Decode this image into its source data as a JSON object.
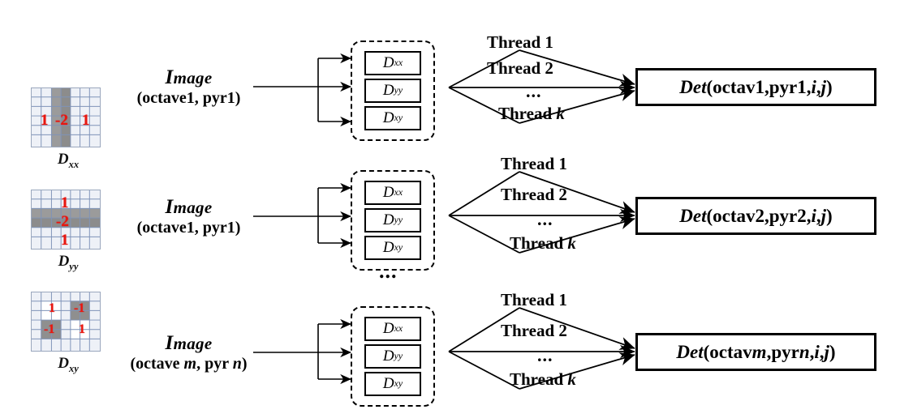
{
  "diagram": {
    "title": "Parallel SURF Hessian determinant computation pipeline",
    "background_color": "#ffffff",
    "accent_red": "#e8160f"
  },
  "kernels": [
    {
      "name": "Dxx",
      "label_base": "D",
      "label_sub": "xx",
      "orientation": "horizontal",
      "values": [
        "1",
        "-2",
        "1"
      ]
    },
    {
      "name": "Dyy",
      "label_base": "D",
      "label_sub": "yy",
      "orientation": "vertical",
      "values": [
        "1",
        "-2",
        "1"
      ]
    },
    {
      "name": "Dxy",
      "label_base": "D",
      "label_sub": "xy",
      "orientation": "quadrant",
      "values": [
        "1",
        "-1",
        "-1",
        "1"
      ]
    }
  ],
  "rows": [
    {
      "image": {
        "word": "Image",
        "cap": "I",
        "rest": "mage",
        "params": "(octave1, pyr1)",
        "params_plain": "(octave1, pyr1)"
      },
      "boxes": [
        {
          "base": "D",
          "sub": "xx"
        },
        {
          "base": "D",
          "sub": "yy"
        },
        {
          "base": "D",
          "sub": "xy"
        }
      ],
      "threads": [
        "Thread 1",
        "Thread 2",
        "Thread k"
      ],
      "thread_dots": "...",
      "det": {
        "prefix": "Det",
        "args": "(octav1,pyr1, ",
        "i": "i",
        "comma": ", ",
        "j": "j",
        "close": ")"
      },
      "group_ellipsis": ""
    },
    {
      "image": {
        "word": "Image",
        "cap": "I",
        "rest": "mage",
        "params": "(octave1, pyr1)",
        "params_plain": "(octave1, pyr1)"
      },
      "boxes": [
        {
          "base": "D",
          "sub": "xx"
        },
        {
          "base": "D",
          "sub": "yy"
        },
        {
          "base": "D",
          "sub": "xy"
        }
      ],
      "threads": [
        "Thread 1",
        "Thread 2",
        "Thread k"
      ],
      "thread_dots": "...",
      "det": {
        "prefix": "Det",
        "args": "(octav2,pyr2, ",
        "i": "i",
        "comma": ", ",
        "j": "j",
        "close": ")"
      },
      "group_ellipsis": "..."
    },
    {
      "image": {
        "word": "Image",
        "cap": "I",
        "rest": "mage",
        "params": "(octave m, pyr n)",
        "params_plain": "(octave m, pyr n)"
      },
      "boxes": [
        {
          "base": "D",
          "sub": "xx"
        },
        {
          "base": "D",
          "sub": "yy"
        },
        {
          "base": "D",
          "sub": "xy"
        }
      ],
      "threads": [
        "Thread 1",
        "Thread 2",
        "Thread k"
      ],
      "thread_dots": "...",
      "det": {
        "prefix": "Det",
        "args": "(octavm,pyrn, ",
        "i": "i",
        "comma": ", ",
        "j": "j",
        "close": ")"
      },
      "group_ellipsis": ""
    }
  ],
  "labels": {
    "thread_1": "Thread 1",
    "thread_2": "Thread 2",
    "thread_k_prefix": "Thread ",
    "thread_k_var": "k",
    "dots": "..."
  }
}
